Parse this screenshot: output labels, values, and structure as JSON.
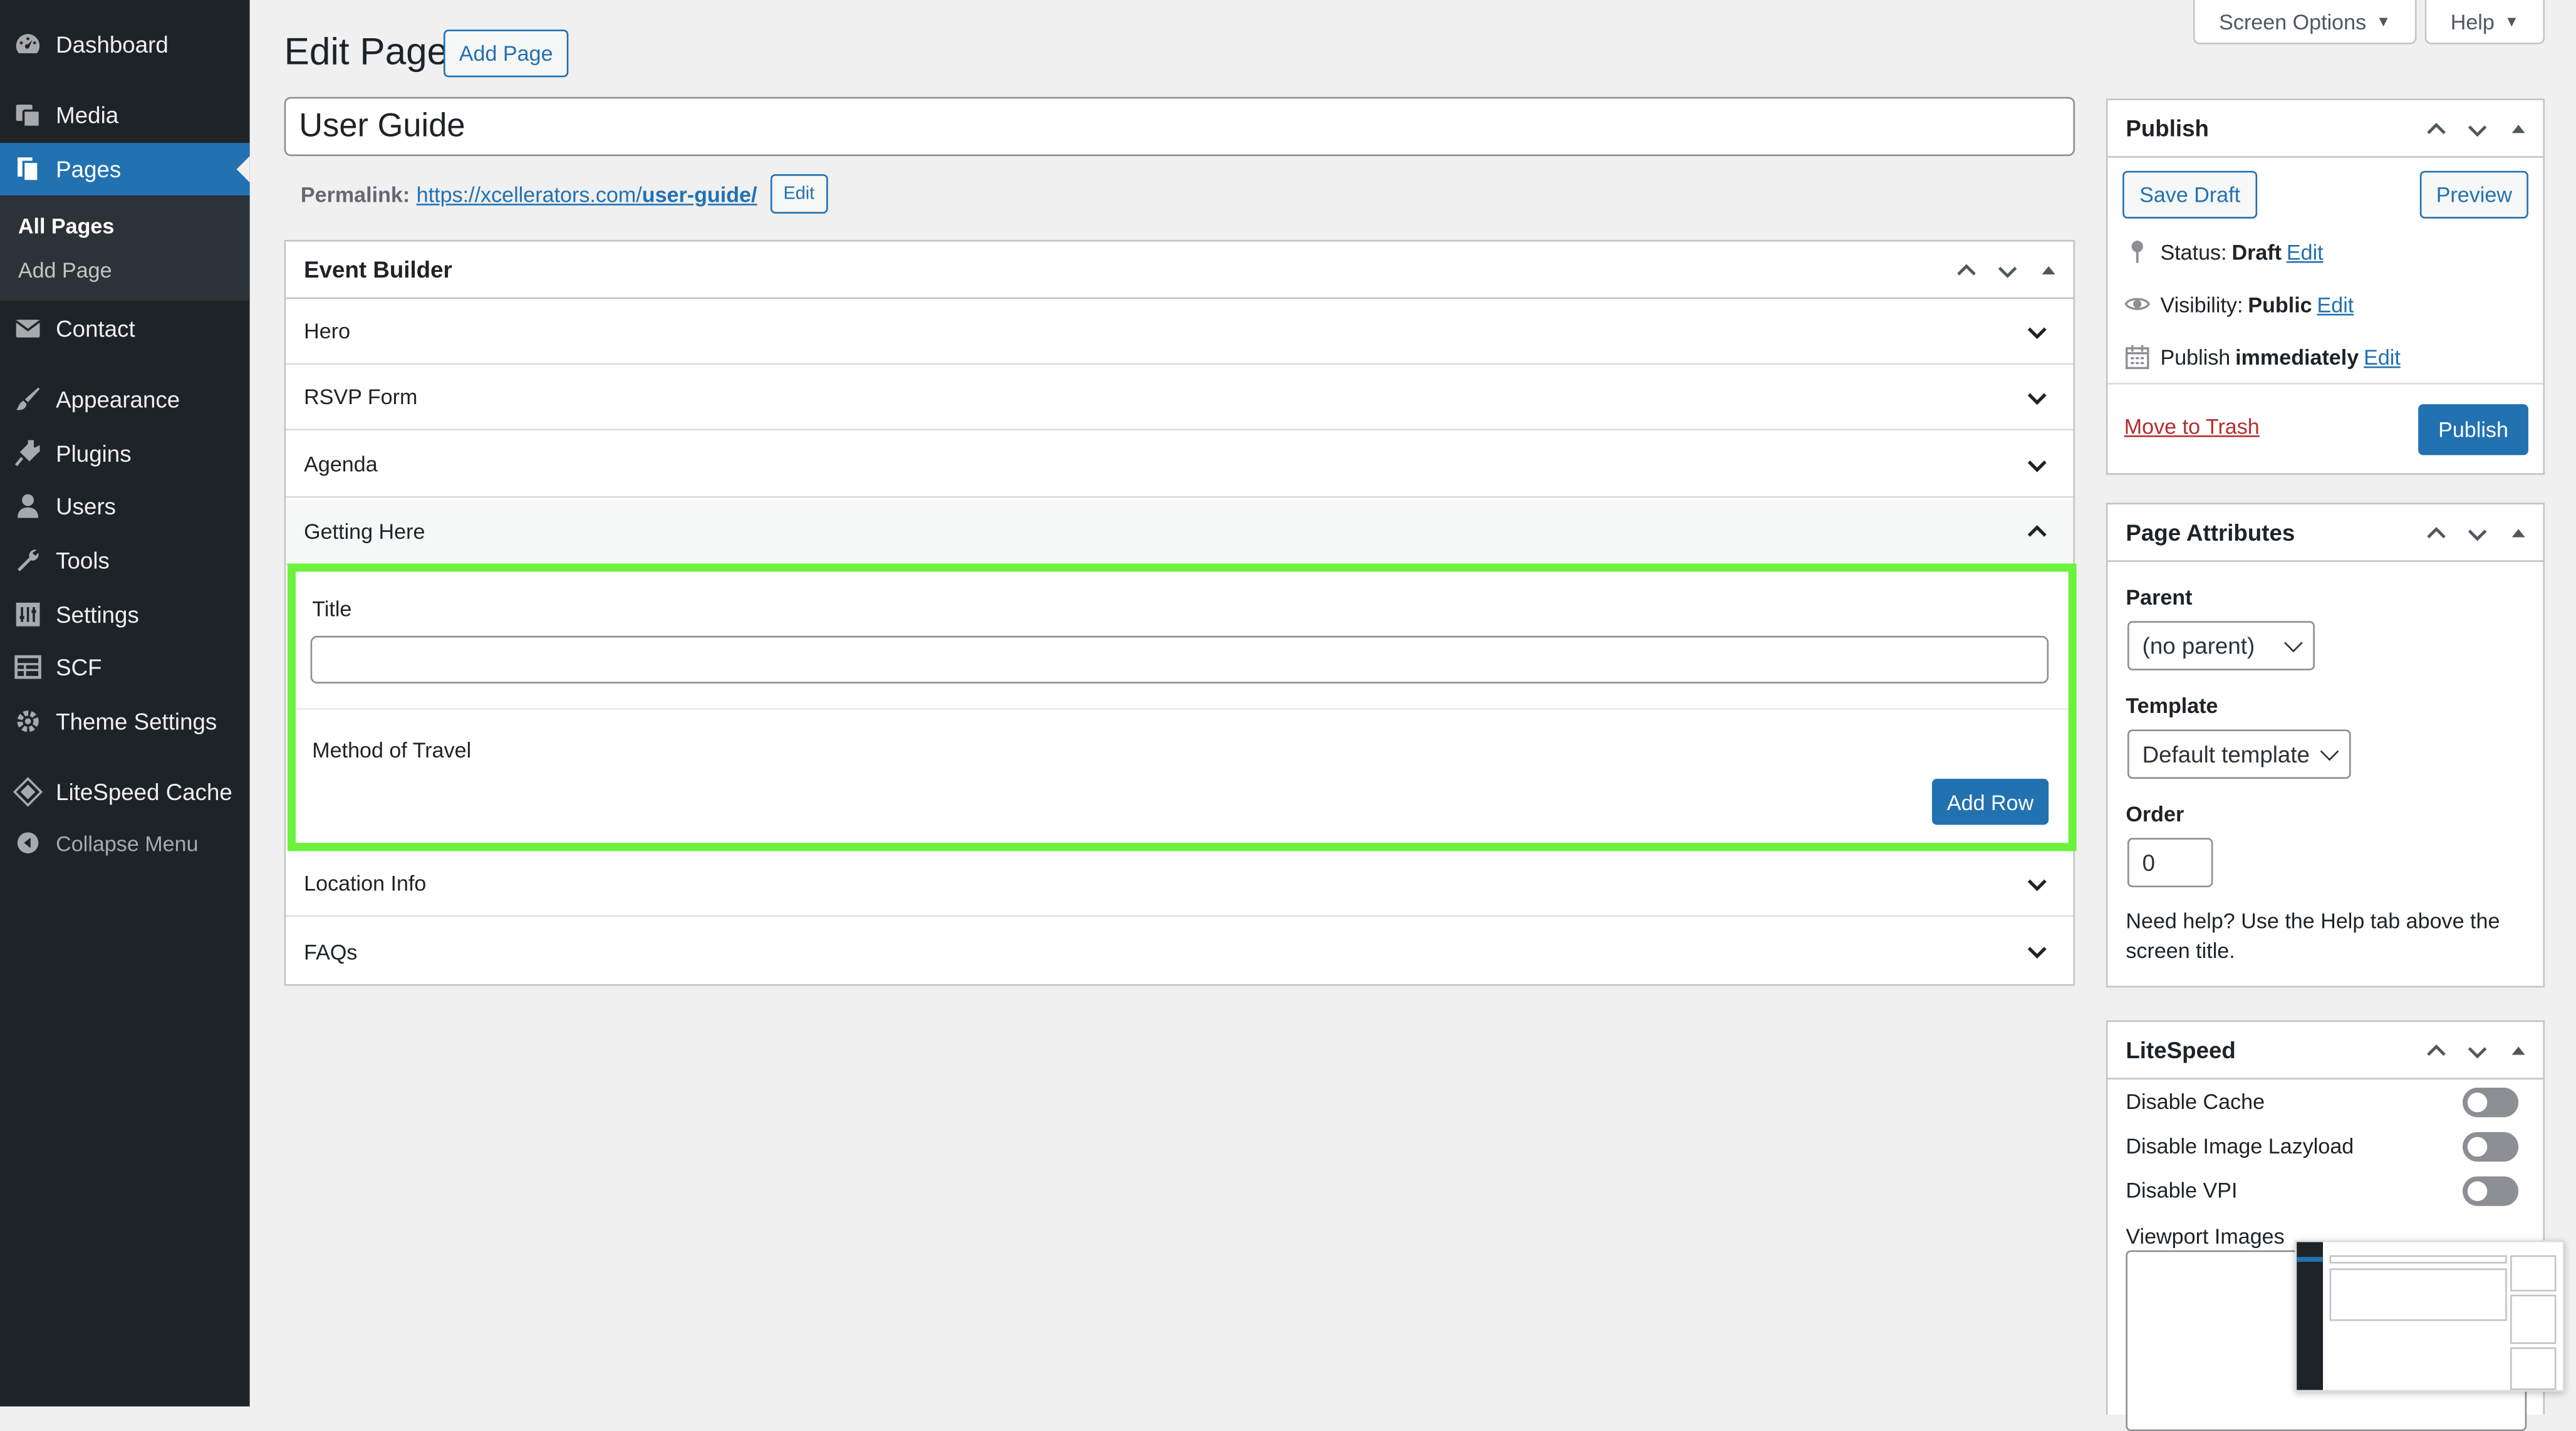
{
  "sidebar": {
    "items": [
      {
        "label": "Dashboard",
        "icon": "dashboard-icon"
      },
      {
        "label": "Media",
        "icon": "media-icon"
      },
      {
        "label": "Pages",
        "icon": "pages-icon"
      },
      {
        "label": "Contact",
        "icon": "mail-icon"
      },
      {
        "label": "Appearance",
        "icon": "brush-icon"
      },
      {
        "label": "Plugins",
        "icon": "plug-icon"
      },
      {
        "label": "Users",
        "icon": "user-icon"
      },
      {
        "label": "Tools",
        "icon": "wrench-icon"
      },
      {
        "label": "Settings",
        "icon": "sliders-icon"
      },
      {
        "label": "SCF",
        "icon": "table-icon"
      },
      {
        "label": "Theme Settings",
        "icon": "gear-icon"
      },
      {
        "label": "LiteSpeed Cache",
        "icon": "diamond-icon"
      }
    ],
    "submenu": [
      "All Pages",
      "Add Page"
    ],
    "collapse_label": "Collapse Menu"
  },
  "header": {
    "title": "Edit Page",
    "add_page_label": "Add Page",
    "screen_options_label": "Screen Options",
    "help_label": "Help"
  },
  "post": {
    "title_value": "User Guide",
    "permalink_label": "Permalink:",
    "permalink_base": "https://xcellerators.com/",
    "permalink_slug": "user-guide/",
    "permalink_edit": "Edit"
  },
  "event_builder": {
    "title": "Event Builder",
    "sections": [
      "Hero",
      "RSVP Form",
      "Agenda",
      "Getting Here",
      "Location Info",
      "FAQs"
    ],
    "open_section": {
      "title_label": "Title",
      "title_value": "",
      "method_label": "Method of Travel",
      "add_row_label": "Add Row"
    }
  },
  "publish": {
    "title": "Publish",
    "save_draft": "Save Draft",
    "preview": "Preview",
    "status_label": "Status:",
    "status_value": "Draft",
    "visibility_label": "Visibility:",
    "visibility_value": "Public",
    "publish_label": "Publish",
    "publish_value": "immediately",
    "edit": "Edit",
    "trash": "Move to Trash",
    "publish_button": "Publish"
  },
  "page_attributes": {
    "title": "Page Attributes",
    "parent_label": "Parent",
    "parent_value": "(no parent)",
    "template_label": "Template",
    "template_value": "Default template",
    "order_label": "Order",
    "order_value": "0",
    "help_text": "Need help? Use the Help tab above the screen title."
  },
  "litespeed": {
    "title": "LiteSpeed",
    "options": [
      "Disable Cache",
      "Disable Image Lazyload",
      "Disable VPI"
    ],
    "viewport_label": "Viewport Images"
  },
  "colors": {
    "sidebar_bg": "#1d2327",
    "accent": "#2271b1",
    "highlight_border": "#6cf23e",
    "trash": "#b32d2e"
  }
}
